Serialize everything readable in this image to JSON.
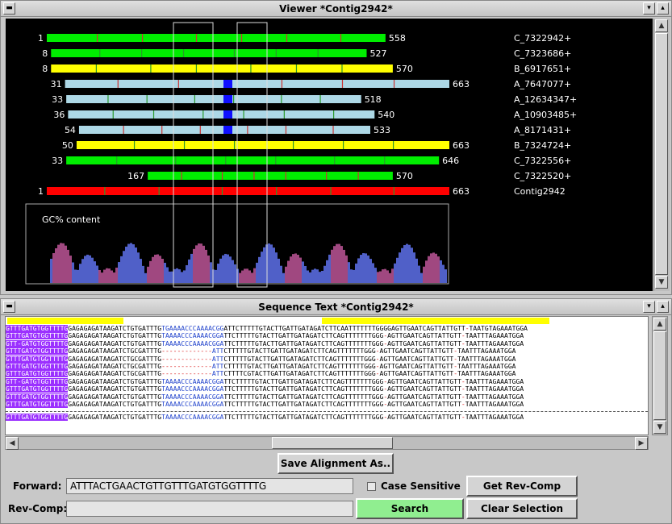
{
  "viewer": {
    "title": "Viewer *Contig2942*",
    "reads": [
      {
        "name": "C_7322942+",
        "start": 1,
        "end": 558,
        "color": "#00ee00"
      },
      {
        "name": "C_7323686+",
        "start": 8,
        "end": 527,
        "color": "#00ee00"
      },
      {
        "name": "B_6917651+",
        "start": 8,
        "end": 570,
        "color": "#ffff00"
      },
      {
        "name": "A_7647077+",
        "start": 31,
        "end": 663,
        "color": "#add8e6"
      },
      {
        "name": "A_12634347+",
        "start": 33,
        "end": 518,
        "color": "#add8e6"
      },
      {
        "name": "A_10903485+",
        "start": 36,
        "end": 540,
        "color": "#add8e6"
      },
      {
        "name": "A_8171431+",
        "start": 54,
        "end": 533,
        "color": "#add8e6"
      },
      {
        "name": "B_7324724+",
        "start": 50,
        "end": 663,
        "color": "#ffff00"
      },
      {
        "name": "C_7322556+",
        "start": 33,
        "end": 646,
        "color": "#00ee00"
      },
      {
        "name": "C_7322520+",
        "start": 167,
        "end": 570,
        "color": "#00ee00"
      },
      {
        "name": "Contig2942",
        "start": 1,
        "end": 663,
        "color": "#ff0000"
      }
    ],
    "gc_label": "GC% content"
  },
  "sequence_panel": {
    "title": "Sequence Text *Contig2942*",
    "lines": [
      "GTTTGATGTGGTTTTGGAGAGAGATAAGATCTGTGATTTGTGAAAACCCAAAACGGATTCTTTTTGTACTTGATTGATAGATCTTCAATTTTTTTGGGGAGTTGAATCAGTTATTGTT-TAATGTAGAAATGGA",
      "GTTTGATGTGGTTTTGGAGAGAGATAAGATCTGTGATTTGTAAAACCCAAAACGGATTCTTTTTGTACTTGATTGATAGATCTTCAGTTTTTTTGGG-AGTTGAATCAGTTATTGTT-TAATTTAGAAATGGA",
      "GTT-GATGTGGTTTTGGAGAGAGATAAGATCTGTGATTTGTAAAACCCAAAACGGATTCTTTTTGTACTTGATTGATAGATCTTCAGTTTTTTTGGG-AGTTGAATCAGTTATTGTT-TAATTTAGAAATGGA",
      "GTTTGATGTGGTTTTGGAGAGAGATAAGATCTGCGATTTG-------------ATTCTTTTTGTACTTGATTGATAGATCTTCAGTTTTTTTGGG-AGTTGAATCAGTTATTGTT-TAATTTAGAAATGGA",
      "GTTTGATGTGGTTTTGGAGAGAGATAAGATCTGCGATTTG-------------ATTCTTTTTGTACTTGATTGATAGATCTTCAGTTTTTTTGGG-AGTTGAATCAGTTATTGTT-TAATTTAGAAATGGA",
      "GTTTGATGTGGTTTTGGAGAGAGATAAGATCTGCGATTTG-------------ATTCTTTTTGTACTTGATTGATAGATCTTCAGTTTTTTTGGG-AGTTGAATCAGTTATTGTT-TAATTTAGAAATGGA",
      "GTTTGATGTGGTTTTGGAGAGAGATAAGATCTGCGATTTG-------------ATTCTTTTCGTACTTGATTGATAGATCTTCAGTTTTTTTGGG-AGTTGAATCAGTTATTGTT-TAATTTAGAAATGGA",
      "GTT-GATGTGGTTTTGGAGAGAGATAAGATCTGTGATTTGTAAAACCCAAAACGGATTCTTTTTGTACTTGATTGATAGATCTTCAGTTTTTTTGGG-AGTTGAATCAGTTATTGTT-TAATTTAGAAATGGA",
      "GTTTGATGTGGTTTTGGAGAGAGATAAGATCTGTGATTTGTAAAACCCAAAACGGATTCTTTTTGTACTTGATTGATAGATCTTCAGTTTTTTTGGG-AGTTGAATCAGTTATTGTT-TAATTTAGAAATGGA",
      "GTTTGATGTGGTTTTGGAGAGAGATAAGATCTGTGATTTGTAAAACCCAAAACGGATTCTTTTTGTACTTGATTGATAGATCTTCAGTTTTTTTGGG-AGTTGAATCAGTTATTGTT-TAATTTAGAAATGGA",
      "GTTTGATGTGGTTTTGGAGAGAGATAAGATCTGTGATTTGTAAAACCCAAAACGGATTCTTTTTGTACTTGATTGATAGATCTTCAGTTTTTTTGGG-AGTTGAATCAGTTATTGTT-TAATTTAGAAATGGA"
    ],
    "consensus": "GTTTGATGTGGTTTTGGAGAGAGATAAGATCTGTGATTTGTAAAACCCAAAACGGATTCTTTTTGTACTTGATTGATAGATCTTCAGTTTTTTTGGG-AGTTGAATCAGTTATTGTT-TAATTTAGAAATGGA"
  },
  "controls": {
    "save_alignment": "Save Alignment As..",
    "forward_label": "Forward:",
    "forward_value": "ATTTACTGAACTGTTGTTTGATGTGGTTTTG",
    "revcomp_label": "Rev-Comp:",
    "revcomp_value": "",
    "case_sensitive": "Case Sensitive",
    "get_rev_comp": "Get Rev-Comp",
    "search": "Search",
    "clear_selection": "Clear Selection"
  }
}
